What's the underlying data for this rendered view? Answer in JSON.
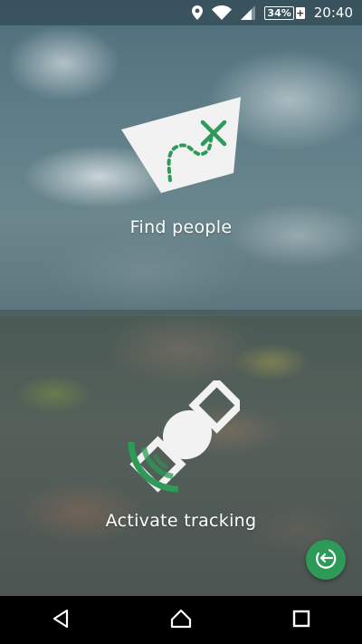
{
  "status_bar": {
    "icons": [
      "location-icon",
      "wifi-icon",
      "signal-icon"
    ],
    "battery_percent": "34%",
    "battery_charging_symbol": "+",
    "time": "20:40"
  },
  "panels": [
    {
      "label": "Find people",
      "icon": "treasure-map-icon"
    },
    {
      "label": "Activate tracking",
      "icon": "satellite-icon"
    }
  ],
  "fab": {
    "icon": "logout-icon"
  },
  "nav_bar": {
    "buttons": [
      "back-icon",
      "home-icon",
      "recents-icon"
    ]
  },
  "colors": {
    "accent": "#2e9a58",
    "text": "#ffffff",
    "nav_background": "#000000"
  }
}
